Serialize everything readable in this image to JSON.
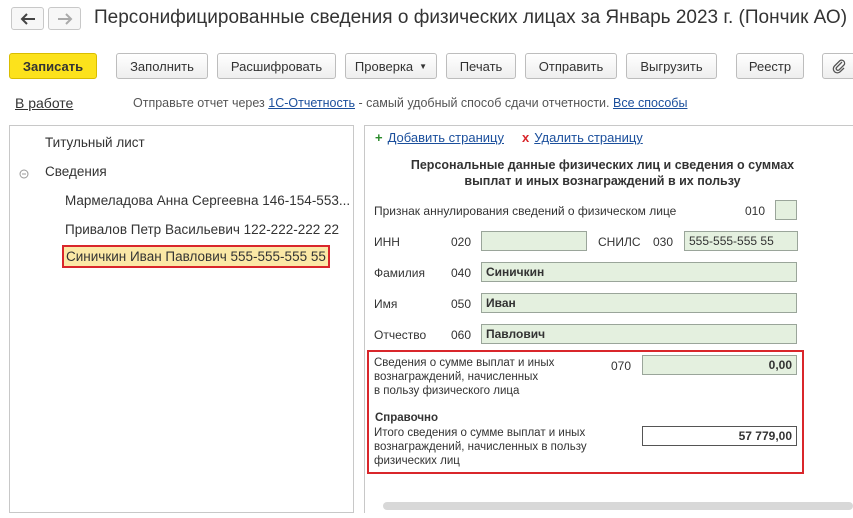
{
  "window": {
    "title": "Персонифицированные сведения о физических лицах за Январь 2023 г. (Пончик АО)"
  },
  "toolbar": {
    "save": "Записать",
    "fill": "Заполнить",
    "decode": "Расшифровать",
    "check": "Проверка",
    "print": "Печать",
    "send": "Отправить",
    "export": "Выгрузить",
    "registry": "Реестр"
  },
  "status": {
    "state": "В работе",
    "info_prefix": "Отправьте отчет через ",
    "info_link": "1С-Отчетность",
    "info_middle": " - самый удобный способ сдачи отчетности. ",
    "info_all_link": "Все способы"
  },
  "tree": {
    "title_page": "Титульный лист",
    "section": "Сведения",
    "items": [
      "Мармеладова Анна Сергеевна 146-154-553...",
      "Привалов Петр Васильевич 122-222-222 22",
      "Синичкин Иван Павлович 555-555-555 55"
    ]
  },
  "form": {
    "add_page": "Добавить страницу",
    "delete_page": "Удалить страницу",
    "heading_line1": "Персональные данные физических лиц и сведения о суммах",
    "heading_line2": "выплат и иных вознаграждений в их пользу",
    "cancel_sign_label": "Признак аннулирования сведений о физическом лице",
    "cancel_sign_code": "010",
    "inn_label": "ИНН",
    "inn_code": "020",
    "inn_value": "",
    "snils_label": "СНИЛС",
    "snils_code": "030",
    "snils_value": "555-555-555 55",
    "surname_label": "Фамилия",
    "surname_code": "040",
    "surname_value": "Синичкин",
    "name_label": "Имя",
    "name_code": "050",
    "name_value": "Иван",
    "patronymic_label": "Отчество",
    "patronymic_code": "060",
    "patronymic_value": "Павлович",
    "payments_line1": "Сведения о сумме выплат и иных",
    "payments_line2": "вознаграждений, начисленных",
    "payments_line3": "в пользу физического лица",
    "payments_code": "070",
    "payments_value": "0,00",
    "reference_title": "Справочно",
    "total_line1": "Итого сведения о сумме выплат и иных",
    "total_line2": "вознаграждений, начисленных в пользу",
    "total_line3": "физических лиц",
    "total_value": "57 779,00"
  },
  "colors": {
    "primary_button": "#fce21c",
    "highlight_border": "#d9262b",
    "selected_row": "#fbe8a6",
    "field_fill": "#e4f0df",
    "link": "#1b4f9c"
  },
  "icons": [
    "back-arrow-icon",
    "forward-arrow-icon",
    "paperclip-icon",
    "collapse-icon",
    "plus-icon",
    "delete-x-icon"
  ]
}
